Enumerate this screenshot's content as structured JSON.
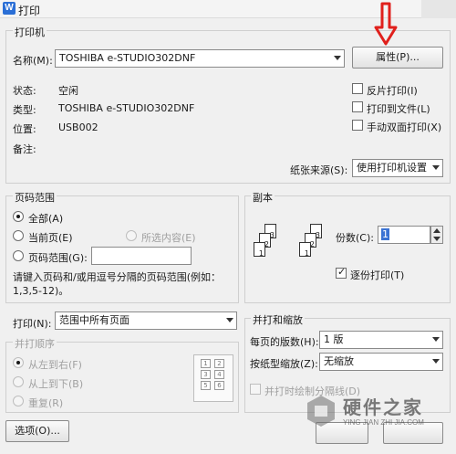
{
  "window": {
    "title": "打印",
    "app_icon_letter": "W"
  },
  "printer": {
    "group_label": "打印机",
    "name_label": "名称(M):",
    "name_value": "TOSHIBA e-STUDIO302DNF",
    "properties_button": "属性(P)...",
    "status_label": "状态:",
    "status_value": "空闲",
    "type_label": "类型:",
    "type_value": "TOSHIBA e-STUDIO302DNF",
    "location_label": "位置:",
    "location_value": "USB002",
    "comment_label": "备注:",
    "reverse_print": "反片打印(I)",
    "print_to_file": "打印到文件(L)",
    "manual_duplex": "手动双面打印(X)",
    "paper_source_label": "纸张来源(S):",
    "paper_source_value": "使用打印机设置"
  },
  "page_range": {
    "group_label": "页码范围",
    "all": "全部(A)",
    "current_page": "当前页(E)",
    "selection": "所选内容(E)",
    "pages": "页码范围(G):",
    "pages_value": "",
    "hint": "请键入页码和/或用逗号分隔的页码范围(例如：1,3,5-12)。"
  },
  "copies": {
    "group_label": "副本",
    "count_label": "份数(C):",
    "count_value": "1",
    "collate": "逐份打印(T)"
  },
  "print_what": {
    "label": "打印(N):",
    "value": "范围中所有页面"
  },
  "order": {
    "group_label": "并打顺序",
    "left_to_right": "从左到右(F)",
    "top_to_bottom": "从上到下(B)",
    "repeat": "重复(R)"
  },
  "zoom": {
    "group_label": "并打和缩放",
    "pages_per_sheet_label": "每页的版数(H):",
    "pages_per_sheet_value": "1 版",
    "scale_label": "按纸型缩放(Z):",
    "scale_value": "无缩放",
    "draw_borders": "并打时绘制分隔线(D)"
  },
  "footer": {
    "options_button": "选项(O)..."
  },
  "watermark": {
    "text": "硬件之家",
    "subtext": "YING JIAN ZHI JIA.COM"
  },
  "colors": {
    "annotation_arrow": "#e0201c",
    "title_icon": "#2b6fd6"
  }
}
